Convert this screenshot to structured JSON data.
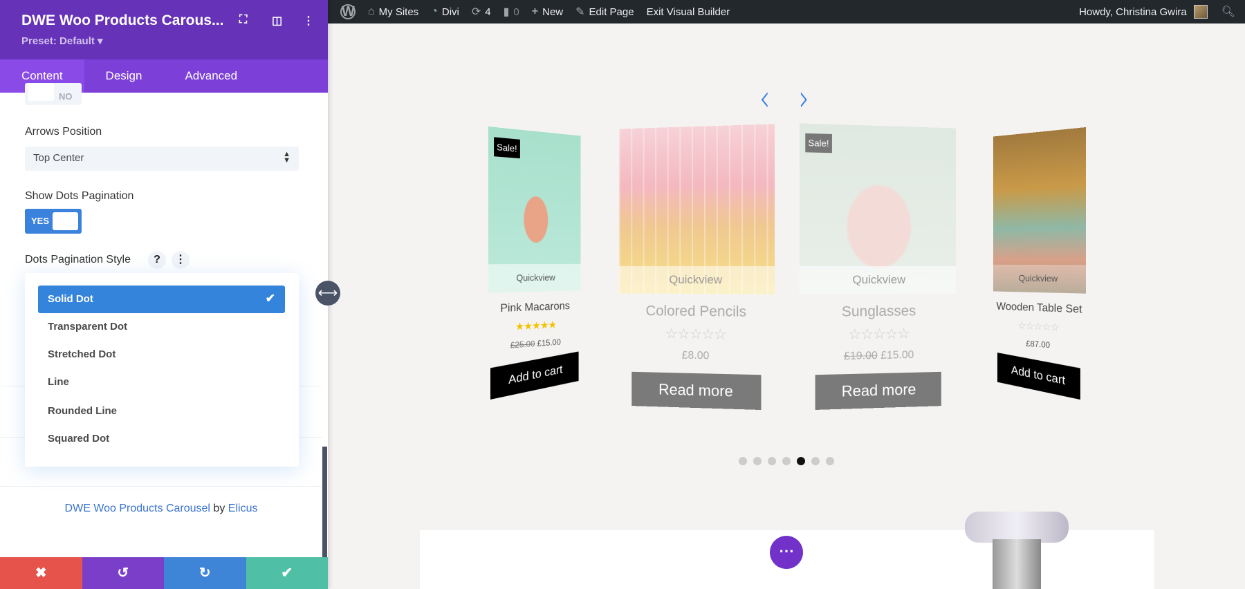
{
  "topbar": {
    "items": [
      {
        "icon": "wordpress-icon",
        "label": ""
      },
      {
        "icon": "my-sites-icon",
        "label": "My Sites"
      },
      {
        "icon": "divi-dashboard-icon",
        "label": "Divi"
      },
      {
        "icon": "updates-icon",
        "label": "4"
      },
      {
        "icon": "comments-icon",
        "label": "0"
      },
      {
        "icon": "plus-icon",
        "label": "New"
      },
      {
        "icon": "pencil-icon",
        "label": "Edit Page"
      },
      {
        "icon": "",
        "label": "Exit Visual Builder"
      }
    ],
    "greeting": "Howdy, Christina Gwira"
  },
  "panel": {
    "title": "DWE Woo Products Carous...",
    "preset": "Preset: Default ▾",
    "tabs": [
      "Content",
      "Design",
      "Advanced"
    ],
    "toggle_prev": "NO",
    "arrows_position_label": "Arrows Position",
    "arrows_position_value": "Top Center",
    "show_dots_label": "Show Dots Pagination",
    "show_dots_value": "YES",
    "dots_style_label": "Dots Pagination Style",
    "help": "?",
    "more": "⋮",
    "dots_style_options": [
      "Solid Dot",
      "Transparent Dot",
      "Stretched Dot",
      "Line",
      "Rounded Line",
      "Squared Dot"
    ],
    "selected_option": "Solid Dot",
    "credit": {
      "plugin": "DWE Woo Products Carousel",
      "by": " by ",
      "author": "Elicus"
    }
  },
  "products": [
    {
      "name": "Pink Macarons",
      "sale": "Sale!",
      "quickview": "Quickview",
      "rating": 5,
      "stars": "★★★★★",
      "old_price": "£25.00",
      "price": "£15.00",
      "button": "Add to cart"
    },
    {
      "name": "Colored Pencils",
      "sale": "",
      "quickview": "Quickview",
      "rating": 0,
      "stars": "☆☆☆☆☆",
      "old_price": "",
      "price": "£8.00",
      "button": "Read more"
    },
    {
      "name": "Sunglasses",
      "sale": "Sale!",
      "quickview": "Quickview",
      "rating": 0,
      "stars": "☆☆☆☆☆",
      "old_price": "£19.00",
      "price": "£15.00",
      "button": "Read more"
    },
    {
      "name": "Wooden Table Set",
      "sale": "",
      "quickview": "Quickview",
      "rating": 0,
      "stars": "☆☆☆☆☆",
      "old_price": "",
      "price": "£87.00",
      "button": "Add to cart"
    }
  ],
  "pagination": {
    "total": 7,
    "active": 5
  },
  "colors": {
    "purple": "#6532b8",
    "blue": "#3584dc",
    "red": "#e5534b",
    "green": "#4fc0a5"
  }
}
